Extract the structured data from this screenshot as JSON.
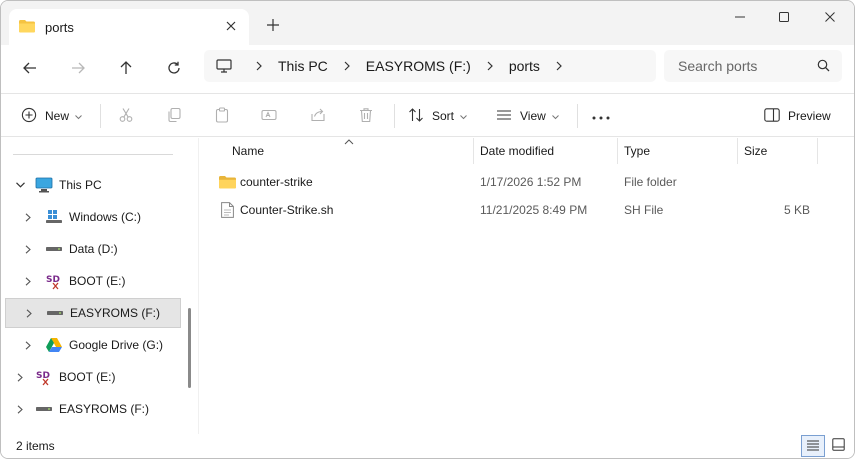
{
  "window": {
    "tab_title": "ports",
    "icons": {
      "folder": "folder-icon",
      "close": "close-icon",
      "new_tab": "plus-icon",
      "minimize": "minimize-icon",
      "maximize": "maximize-icon",
      "window_close": "close-icon"
    }
  },
  "address_bar": {
    "breadcrumbs": [
      "This PC",
      "EASYROMS (F:)",
      "ports"
    ],
    "search_placeholder": "Search ports"
  },
  "command_bar": {
    "new_label": "New",
    "sort_label": "Sort",
    "view_label": "View",
    "preview_label": "Preview"
  },
  "sidebar": {
    "items": [
      {
        "label": "This PC",
        "icon": "pc-icon",
        "expanded": true
      },
      {
        "label": "Windows (C:)",
        "icon": "windows-drive-icon"
      },
      {
        "label": "Data (D:)",
        "icon": "drive-icon"
      },
      {
        "label": "BOOT (E:)",
        "icon": "sd-card-icon"
      },
      {
        "label": "EASYROMS (F:)",
        "icon": "drive-icon",
        "selected": true
      },
      {
        "label": "Google Drive (G:)",
        "icon": "google-drive-icon"
      },
      {
        "label": "BOOT (E:)",
        "icon": "sd-card-icon"
      },
      {
        "label": "EASYROMS (F:)",
        "icon": "drive-icon"
      }
    ]
  },
  "file_list": {
    "columns": [
      "Name",
      "Date modified",
      "Type",
      "Size"
    ],
    "rows": [
      {
        "name": "counter-strike",
        "date": "1/17/2026 1:52 PM",
        "type": "File folder",
        "size": "",
        "icon": "folder-icon"
      },
      {
        "name": "Counter-Strike.sh",
        "date": "11/21/2025 8:49 PM",
        "type": "SH File",
        "size": "5 KB",
        "icon": "file-icon"
      }
    ]
  },
  "status_bar": {
    "item_count": "2 items"
  },
  "colors": {
    "folder": "#f5c342",
    "selection": "#e5e5e5",
    "accent": "#2d6bc6"
  }
}
